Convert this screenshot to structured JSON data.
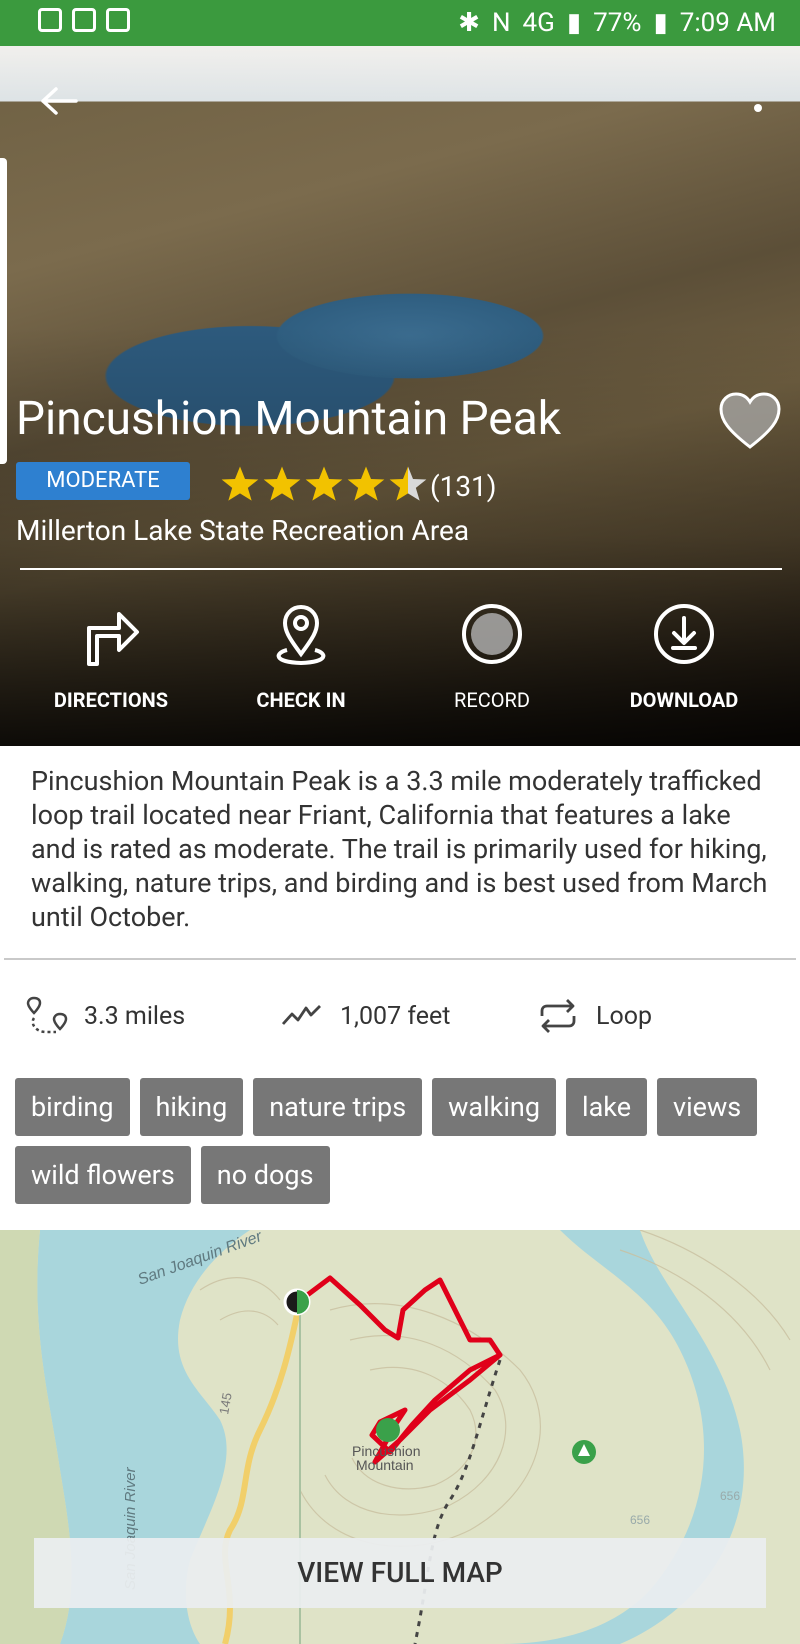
{
  "status_bar": {
    "battery": "77%",
    "time": "7:09 AM",
    "network": "4G",
    "left_icons": [
      "shield-icon",
      "pulse-icon",
      "mail-icon"
    ],
    "right_icons": [
      "bluetooth-icon",
      "nfc-icon",
      "signal-icon",
      "battery-icon"
    ]
  },
  "header": {
    "back_icon": "back-arrow-icon",
    "menu_icon": "overflow-menu-icon"
  },
  "trail": {
    "name": "Pincushion Mountain Peak",
    "difficulty": "MODERATE",
    "rating": 4.5,
    "review_count": "(131)",
    "park": "Millerton Lake State Recreation Area",
    "favorite_icon": "heart-icon"
  },
  "actions": [
    {
      "label": "DIRECTIONS",
      "icon": "directions-icon"
    },
    {
      "label": "CHECK IN",
      "icon": "location-pin-icon"
    },
    {
      "label": "RECORD",
      "icon": "record-icon"
    },
    {
      "label": "DOWNLOAD",
      "icon": "download-icon"
    }
  ],
  "description": "Pincushion Mountain Peak  is a 3.3 mile moderately trafficked loop trail located near Friant, California that features a lake and is rated as moderate. The trail is primarily used for hiking, walking, nature trips, and birding and is best used from March until October.",
  "stats": [
    {
      "value": "3.3 miles",
      "icon": "distance-icon"
    },
    {
      "value": "1,007 feet",
      "icon": "elevation-icon"
    },
    {
      "value": "Loop",
      "icon": "loop-icon"
    }
  ],
  "tags": [
    "birding",
    "hiking",
    "nature trips",
    "walking",
    "lake",
    "views",
    "wild flowers",
    "no dogs"
  ],
  "map": {
    "labels": [
      "San Joaquin River",
      "San Joaquin River",
      "Pincushion Mountain"
    ],
    "road_numbers": [
      "145",
      "656",
      "656",
      "656"
    ],
    "button_label": "VIEW FULL MAP",
    "colors": {
      "water": "#a9d6dc",
      "land": "#dfe3c7",
      "route": "#e0001a",
      "road": "#f1cf6a"
    }
  },
  "colors": {
    "status_bar": "#3b9a3e",
    "badge": "#2e80d0",
    "star": "#f2c200",
    "tag": "#777777"
  }
}
